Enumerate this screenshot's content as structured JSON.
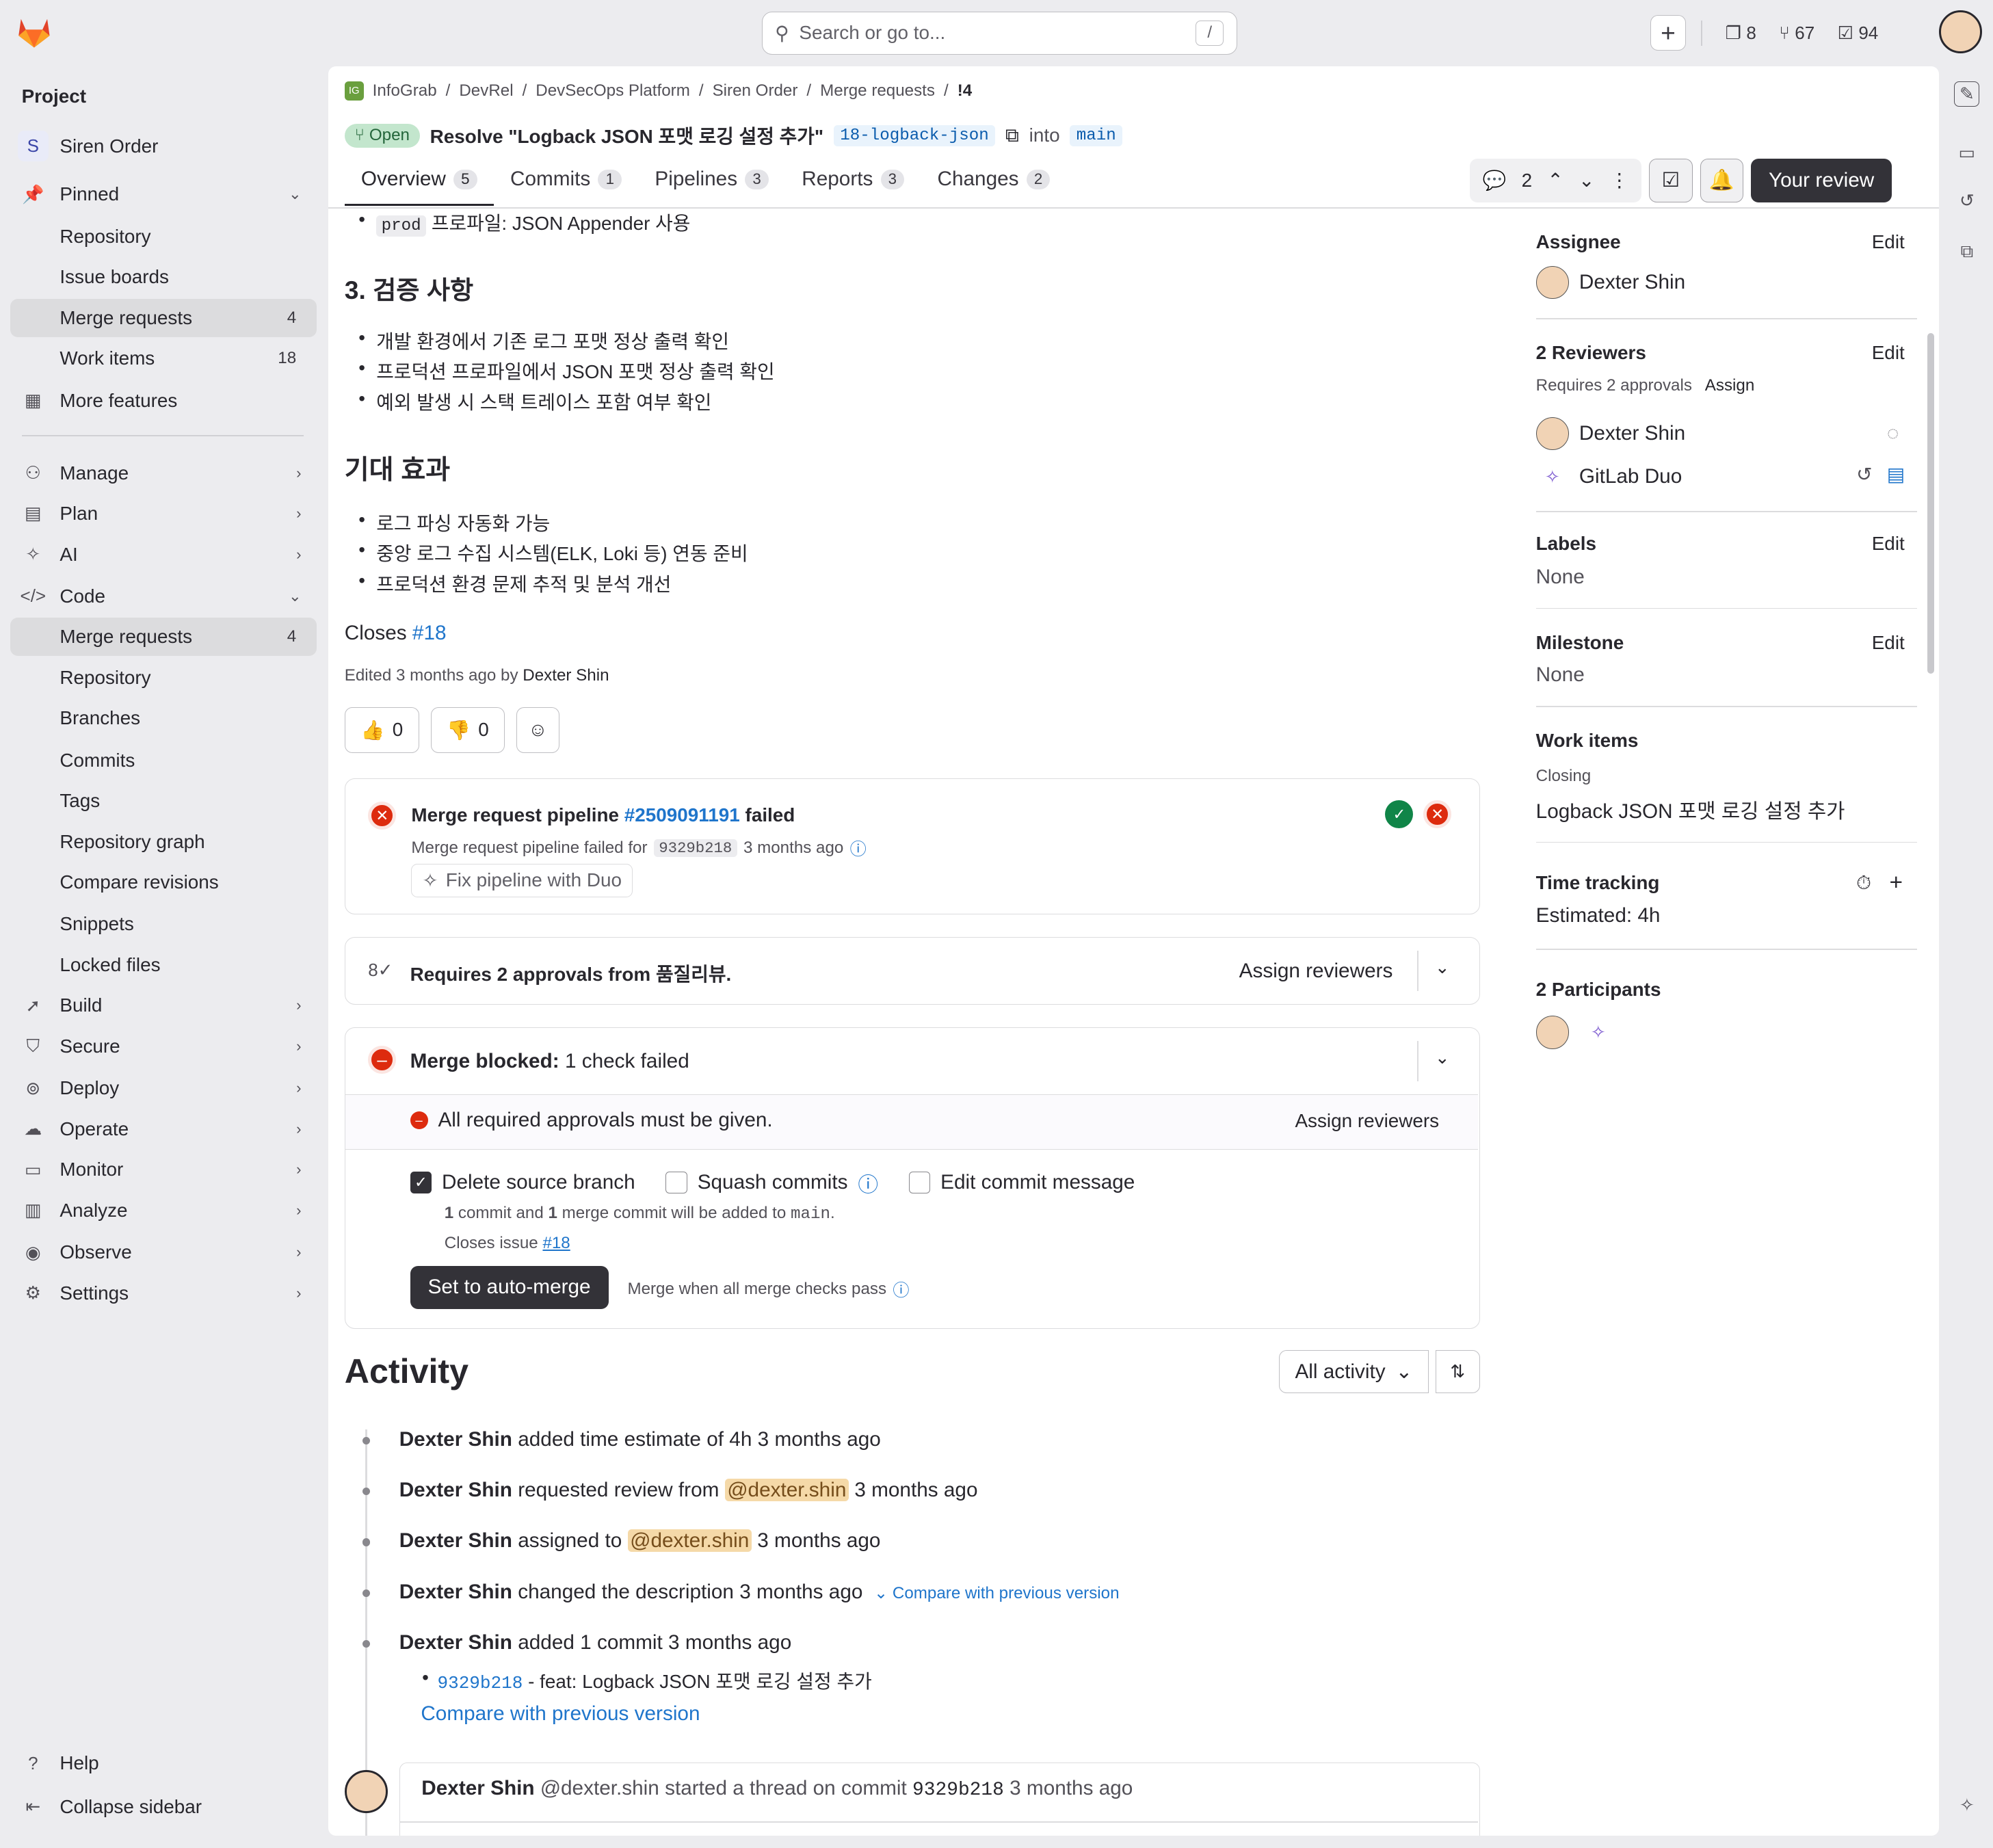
{
  "search": {
    "placeholder": "Search or go to...",
    "shortcut": "/"
  },
  "topbar": {
    "issues": "8",
    "mrs": "67",
    "todos": "94"
  },
  "sidebar": {
    "section": "Project",
    "project_initial": "S",
    "project": "Siren Order",
    "pinned": "Pinned",
    "pinned_items": [
      {
        "label": "Repository"
      },
      {
        "label": "Issue boards"
      },
      {
        "label": "Merge requests",
        "count": "4"
      },
      {
        "label": "Work items",
        "count": "18"
      }
    ],
    "more": "More features",
    "groups": [
      "Manage",
      "Plan",
      "AI",
      "Code"
    ],
    "code_items": [
      {
        "label": "Merge requests",
        "count": "4"
      },
      {
        "label": "Repository"
      },
      {
        "label": "Branches"
      },
      {
        "label": "Commits"
      },
      {
        "label": "Tags"
      },
      {
        "label": "Repository graph"
      },
      {
        "label": "Compare revisions"
      },
      {
        "label": "Snippets"
      },
      {
        "label": "Locked files"
      }
    ],
    "groups2": [
      "Build",
      "Secure",
      "Deploy",
      "Operate",
      "Monitor",
      "Analyze",
      "Observe",
      "Settings"
    ],
    "help": "Help",
    "collapse": "Collapse sidebar"
  },
  "breadcrumb": [
    "InfoGrab",
    "DevRel",
    "DevSecOps Platform",
    "Siren Order",
    "Merge requests",
    "!4"
  ],
  "mr": {
    "status": "Open",
    "title": "Resolve \"Logback JSON 포맷 로깅 설정 추가\"",
    "source": "18-logback-json",
    "into": "into",
    "target": "main"
  },
  "tabs": [
    {
      "label": "Overview",
      "count": "5"
    },
    {
      "label": "Commits",
      "count": "1"
    },
    {
      "label": "Pipelines",
      "count": "3"
    },
    {
      "label": "Reports",
      "count": "3"
    },
    {
      "label": "Changes",
      "count": "2"
    }
  ],
  "toolbar": {
    "threads": "2",
    "review": "Your review"
  },
  "desc": {
    "prod_code": "prod",
    "prod_text": "프로파일: JSON Appender 사용",
    "h_verify": "3. 검증 사항",
    "verify": [
      "개발 환경에서 기존 로그 포맷 정상 출력 확인",
      "프로덕션 프로파일에서 JSON 포맷 정상 출력 확인",
      "예외 발생 시 스택 트레이스 포함 여부 확인"
    ],
    "h_effect": "기대 효과",
    "effect": [
      "로그 파싱 자동화 가능",
      "중앙 로그 수집 시스템(ELK, Loki 등) 연동 준비",
      "프로덕션 환경 문제 추적 및 분석 개선"
    ],
    "closes": "Closes",
    "closes_ref": "#18",
    "edited": "Edited 3 months ago by",
    "edited_by": "Dexter Shin"
  },
  "reactions": {
    "up": "0",
    "down": "0"
  },
  "pipeline": {
    "title_pre": "Merge request pipeline",
    "id": "#2509091191",
    "status": "failed",
    "detail_pre": "Merge request pipeline failed for",
    "sha": "9329b218",
    "time": "3 months ago",
    "fix": "Fix pipeline with Duo"
  },
  "approvals": {
    "text": "Requires 2 approvals from 품질리뷰.",
    "assign": "Assign reviewers"
  },
  "merge": {
    "blocked_label": "Merge blocked:",
    "blocked_detail": "1 check failed",
    "check": "All required approvals must be given.",
    "assign": "Assign reviewers",
    "delete_src": "Delete source branch",
    "squash": "Squash commits",
    "edit_msg": "Edit commit message",
    "info1_a": "1",
    "info1_b": "commit and",
    "info1_c": "1",
    "info1_d": "merge commit will be added to",
    "info1_e": "main",
    "info2": "Closes issue",
    "info2_ref": "#18",
    "auto": "Set to auto-merge",
    "auto_hint": "Merge when all merge checks pass"
  },
  "activity": {
    "title": "Activity",
    "filter": "All activity",
    "items": [
      {
        "who": "Dexter Shin",
        "what": "added time estimate of 4h",
        "when": "3 months ago"
      },
      {
        "who": "Dexter Shin",
        "what": "requested review from",
        "mention": "@dexter.shin",
        "when": "3 months ago"
      },
      {
        "who": "Dexter Shin",
        "what": "assigned to",
        "mention": "@dexter.shin",
        "when": "3 months ago"
      },
      {
        "who": "Dexter Shin",
        "what": "changed the description",
        "when": "3 months ago",
        "link": "Compare with previous version"
      },
      {
        "who": "Dexter Shin",
        "what": "added 1 commit",
        "when": "3 months ago"
      }
    ],
    "commit_sha": "9329b218",
    "commit_msg": "- feat: Logback JSON 포맷 로깅 설정 추가",
    "compare": "Compare with previous version",
    "thread_who": "Dexter Shin",
    "thread_handle": "@dexter.shin",
    "thread_text": "started a thread on commit",
    "thread_sha": "9329b218",
    "thread_when": "3 months ago"
  },
  "right": {
    "assignee_t": "Assignee",
    "edit": "Edit",
    "assignee": "Dexter Shin",
    "reviewers_t": "2 Reviewers",
    "req": "Requires 2 approvals",
    "assign": "Assign",
    "rev1": "Dexter Shin",
    "rev2": "GitLab Duo",
    "labels_t": "Labels",
    "labels": "None",
    "milestone_t": "Milestone",
    "milestone": "None",
    "work_t": "Work items",
    "closing": "Closing",
    "work": "Logback JSON 포맷 로깅 설정 추가",
    "time_t": "Time tracking",
    "estimate": "Estimated: 4h",
    "participants_t": "2 Participants"
  }
}
